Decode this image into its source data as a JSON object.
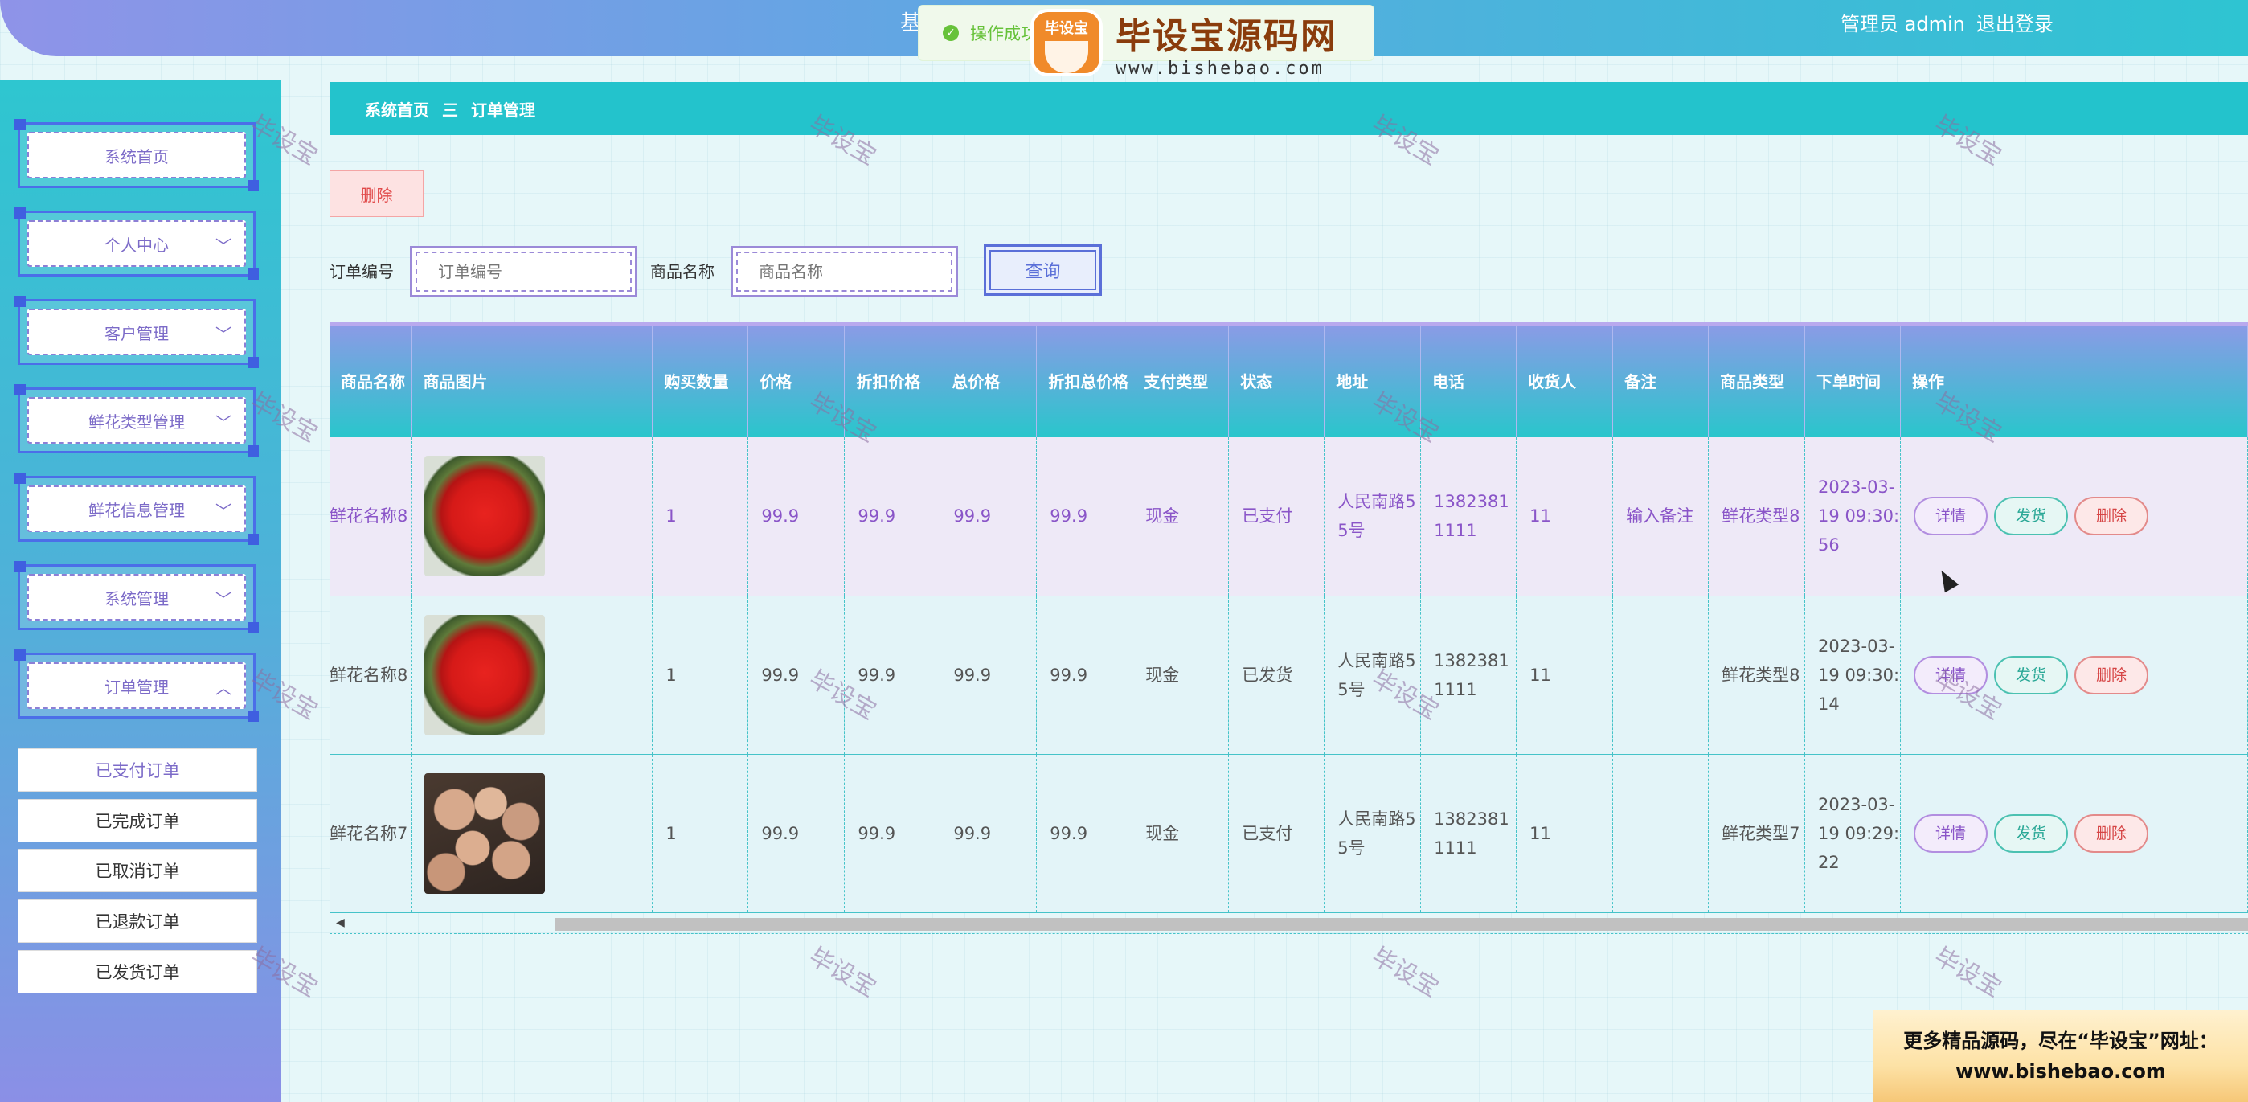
{
  "header": {
    "title_fragment": "基",
    "user_label": "管理员 admin",
    "logout": "退出登录"
  },
  "toast": {
    "message": "操作成功"
  },
  "logo_watermark": {
    "badge": "毕设宝",
    "name": "毕设宝源码网",
    "url": "www.bishebao.com"
  },
  "sidebar": {
    "items": [
      {
        "label": "系统首页",
        "has_arrow": false
      },
      {
        "label": "个人中心",
        "has_arrow": true
      },
      {
        "label": "客户管理",
        "has_arrow": true
      },
      {
        "label": "鲜花类型管理",
        "has_arrow": true
      },
      {
        "label": "鲜花信息管理",
        "has_arrow": true
      },
      {
        "label": "系统管理",
        "has_arrow": true
      },
      {
        "label": "订单管理",
        "has_arrow": true,
        "expanded": true
      }
    ],
    "submenu": [
      {
        "label": "已支付订单",
        "active": true
      },
      {
        "label": "已完成订单"
      },
      {
        "label": "已取消订单"
      },
      {
        "label": "已退款订单"
      },
      {
        "label": "已发货订单"
      }
    ]
  },
  "breadcrumb": {
    "home": "系统首页",
    "separator": "三",
    "current": "订单管理"
  },
  "toolbar": {
    "delete_label": "删除"
  },
  "search": {
    "order_label": "订单编号",
    "order_placeholder": "订单编号",
    "goods_label": "商品名称",
    "goods_placeholder": "商品名称",
    "query_label": "查询"
  },
  "table": {
    "headers": [
      "商品名称",
      "商品图片",
      "购买数量",
      "价格",
      "折扣价格",
      "总价格",
      "折扣总价格",
      "支付类型",
      "状态",
      "地址",
      "电话",
      "收货人",
      "备注",
      "商品类型",
      "下单时间",
      "操作"
    ],
    "rows": [
      {
        "name": "鲜花名称8",
        "image": "red-roses",
        "qty": "1",
        "price": "99.9",
        "discount_price": "99.9",
        "total": "99.9",
        "discount_total": "99.9",
        "pay_type": "现金",
        "status": "已支付",
        "address": "人民南路55号",
        "phone": "13823811111",
        "receiver": "11",
        "remark": "输入备注",
        "category": "鲜花类型8",
        "time": "2023-03-19 09:30:56"
      },
      {
        "name": "鲜花名称8",
        "image": "red-roses",
        "qty": "1",
        "price": "99.9",
        "discount_price": "99.9",
        "total": "99.9",
        "discount_total": "99.9",
        "pay_type": "现金",
        "status": "已发货",
        "address": "人民南路55号",
        "phone": "13823811111",
        "receiver": "11",
        "remark": "",
        "category": "鲜花类型8",
        "time": "2023-03-19 09:30:14"
      },
      {
        "name": "鲜花名称7",
        "image": "champagne-roses",
        "qty": "1",
        "price": "99.9",
        "discount_price": "99.9",
        "total": "99.9",
        "discount_total": "99.9",
        "pay_type": "现金",
        "status": "已支付",
        "address": "人民南路55号",
        "phone": "13823811111",
        "receiver": "11",
        "remark": "",
        "category": "鲜花类型7",
        "time": "2023-03-19 09:29:22"
      }
    ],
    "actions": {
      "detail": "详情",
      "ship": "发货",
      "delete": "删除"
    }
  },
  "watermark_text": "毕设宝",
  "promo": {
    "line1": "更多精品源码，尽在“毕设宝”网址：",
    "line2": "www.bishebao.com"
  }
}
